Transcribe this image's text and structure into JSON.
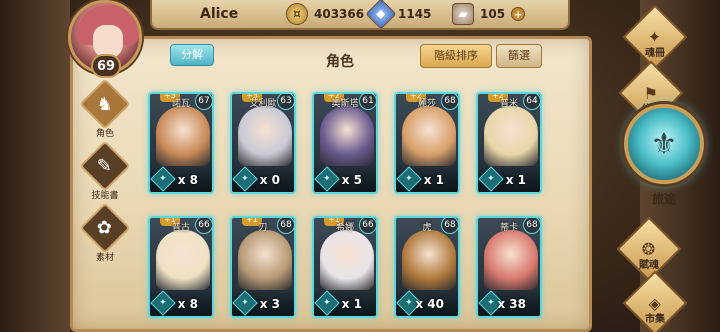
{
  "player": {
    "name": "Alice",
    "level": "69"
  },
  "resources": {
    "gold": "403366",
    "gem": "1145",
    "stone": "105",
    "plus": "+"
  },
  "left_menu": [
    {
      "label": "角色",
      "icon": "character-icon",
      "glyph": "♞"
    },
    {
      "label": "技能書",
      "icon": "skill-book-icon",
      "glyph": "✎"
    },
    {
      "label": "素材",
      "icon": "material-icon",
      "glyph": "✿"
    }
  ],
  "header": {
    "split_label": "分解",
    "title": "角色",
    "sort_label": "階級排序",
    "filter_label": "篩選"
  },
  "heroes": [
    {
      "name": "諾瓦",
      "level": "67",
      "stars": "+3",
      "count": "x 8",
      "color": "#c98a58"
    },
    {
      "name": "艾利歐",
      "level": "63",
      "stars": "+3",
      "count": "x 0",
      "color": "#c9c9d6"
    },
    {
      "name": "奧斯塔",
      "level": "61",
      "stars": "+2",
      "count": "x 5",
      "color": "#6a5a8e"
    },
    {
      "name": "麗莎",
      "level": "68",
      "stars": "+2",
      "count": "x 1",
      "color": "#d8a06a"
    },
    {
      "name": "普米",
      "level": "64",
      "stars": "+2",
      "count": "x 1",
      "color": "#e8d6a8"
    },
    {
      "name": "普古",
      "level": "66",
      "stars": "+1",
      "count": "x 8",
      "color": "#efe2c4"
    },
    {
      "name": "刃",
      "level": "68",
      "stars": "+1",
      "count": "x 3",
      "color": "#b79a74"
    },
    {
      "name": "希娜",
      "level": "66",
      "stars": "+1",
      "count": "x 1",
      "color": "#e9e4e8"
    },
    {
      "name": "虎",
      "level": "68",
      "stars": "",
      "count": "x 40",
      "color": "#b07a3c"
    },
    {
      "name": "蒂卡",
      "level": "68",
      "stars": "",
      "count": "x 38",
      "color": "#d9796e"
    }
  ],
  "right_menu": {
    "codex": {
      "label": "魂冊",
      "icon": "codex-icon",
      "glyph": "✦"
    },
    "guild": {
      "label": "公會",
      "icon": "guild-icon",
      "glyph": "⚑"
    },
    "journey": {
      "label": "旅途",
      "icon": "journey-icon",
      "glyph": "⚜"
    },
    "blessing": {
      "label": "賦魂",
      "icon": "blessing-icon",
      "glyph": "❂"
    },
    "market": {
      "label": "市集",
      "icon": "market-icon",
      "glyph": "◈"
    }
  }
}
